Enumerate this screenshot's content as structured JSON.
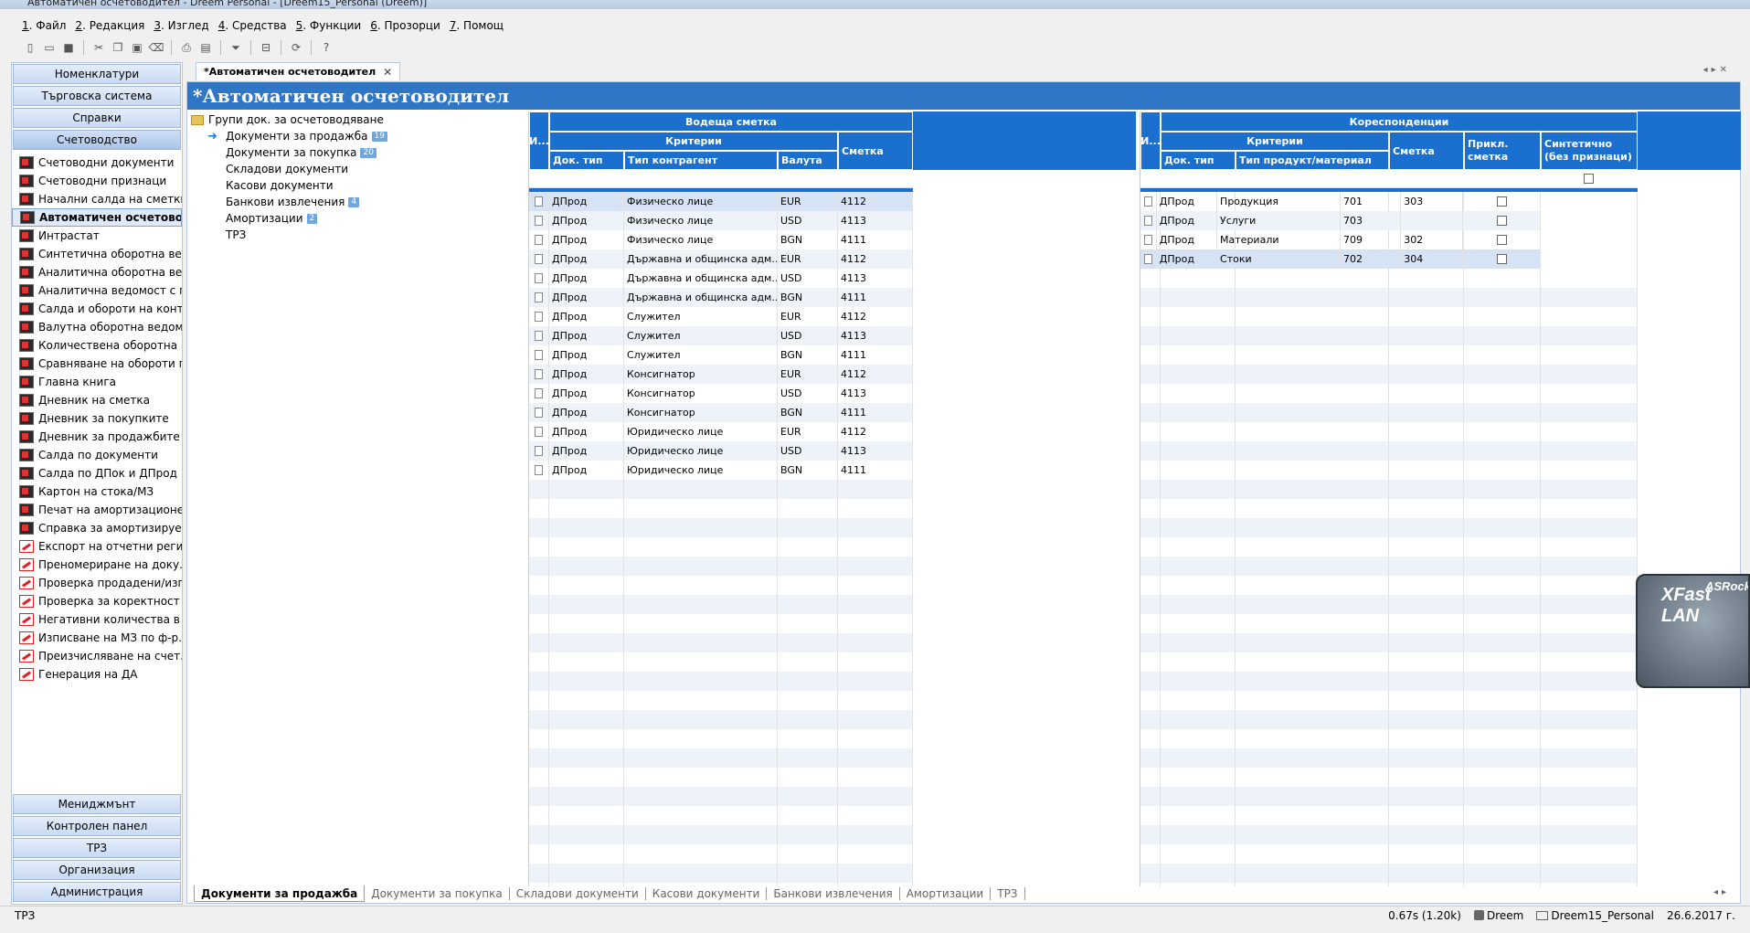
{
  "window": {
    "title": "Автоматичен осчетоводител - Dreem Personal - [Dreem15_Personal (Dreem)]"
  },
  "menu": [
    {
      "num": "1",
      "label": ". Файл"
    },
    {
      "num": "2",
      "label": ". Редакция"
    },
    {
      "num": "3",
      "label": ". Изглед"
    },
    {
      "num": "4",
      "label": ". Средства"
    },
    {
      "num": "5",
      "label": ". Функции"
    },
    {
      "num": "6",
      "label": ". Прозорци"
    },
    {
      "num": "7",
      "label": ". Помощ"
    }
  ],
  "nav": {
    "top_groups": [
      "Номенклатури",
      "Търговска система",
      "Справки",
      "Счетоводство"
    ],
    "items": [
      "Счетоводни документи",
      "Счетоводни признаци",
      "Начални салда на сметки",
      "Автоматичен осчетовод...",
      "Интрастат",
      "Синтетична оборотна вед...",
      "Аналитична оборотна ве...",
      "Аналитична ведомост с п...",
      "Салда и обороти на конт...",
      "Валутна оборотна ведом...",
      "Количествена оборотна в...",
      "Сравняване на обороти п...",
      "Главна книга",
      "Дневник на сметка",
      "Дневник за покупките",
      "Дневник за продажбите",
      "Салда по документи",
      "Салда по ДПок и ДПрод",
      "Картон на стока/МЗ",
      "Печат на амортизационе...",
      "Справка за амортизируе...",
      "Експорт на отчетни регис...",
      "Преномериране на доку...",
      "Проверка продадени/изп...",
      "Проверка за коректност ...",
      "Негативни количества в с...",
      "Изписване на МЗ по ф-р...",
      "Преизчисляване на счет. ...",
      "Генерация на ДА"
    ],
    "bottom_groups": [
      "Мениджмънт",
      "Контролен панел",
      "ТРЗ",
      "Организация",
      "Администрация"
    ]
  },
  "doc_tab": {
    "label": "*Автоматичен осчетоводител",
    "close": "✕"
  },
  "page_title": "*Автоматичен осчетоводител",
  "tree": {
    "root": "Групи док. за осчетоводяване",
    "nodes": [
      {
        "label": "Документи за продажба",
        "badge": "19"
      },
      {
        "label": "Документи за покупка",
        "badge": "20"
      },
      {
        "label": "Складови документи",
        "badge": ""
      },
      {
        "label": "Касови документи",
        "badge": ""
      },
      {
        "label": "Банкови извлечения",
        "badge": "4"
      },
      {
        "label": "Амортизации",
        "badge": "2"
      },
      {
        "label": "ТРЗ",
        "badge": ""
      }
    ]
  },
  "left_grid": {
    "group_title": "Водеща сметка",
    "criteria_title": "Критерии",
    "col_i": "И...",
    "columns": {
      "doc_type": "Док. тип",
      "contractor_type": "Тип контрагент",
      "currency": "Валута",
      "account": "Сметка"
    },
    "rows": [
      [
        "ДПрод",
        "Физическо лице",
        "EUR",
        "4112"
      ],
      [
        "ДПрод",
        "Физическо лице",
        "USD",
        "4113"
      ],
      [
        "ДПрод",
        "Физическо лице",
        "BGN",
        "4111"
      ],
      [
        "ДПрод",
        "Държавна и общинска адм...",
        "EUR",
        "4112"
      ],
      [
        "ДПрод",
        "Държавна и общинска адм...",
        "USD",
        "4113"
      ],
      [
        "ДПрод",
        "Държавна и общинска адм...",
        "BGN",
        "4111"
      ],
      [
        "ДПрод",
        "Служител",
        "EUR",
        "4112"
      ],
      [
        "ДПрод",
        "Служител",
        "USD",
        "4113"
      ],
      [
        "ДПрод",
        "Служител",
        "BGN",
        "4111"
      ],
      [
        "ДПрод",
        "Консигнатор",
        "EUR",
        "4112"
      ],
      [
        "ДПрод",
        "Консигнатор",
        "USD",
        "4113"
      ],
      [
        "ДПрод",
        "Консигнатор",
        "BGN",
        "4111"
      ],
      [
        "ДПрод",
        "Юридическо лице",
        "EUR",
        "4112"
      ],
      [
        "ДПрод",
        "Юридическо лице",
        "USD",
        "4113"
      ],
      [
        "ДПрод",
        "Юридическо лице",
        "BGN",
        "4111"
      ]
    ]
  },
  "right_grid": {
    "group_title": "Кореспонденции",
    "criteria_title": "Критерии",
    "col_i": "И...",
    "columns": {
      "doc_type": "Док. тип",
      "product_type": "Тип продукт/материал",
      "account": "Сметка",
      "attached_account": "Прикл. сметка",
      "synthetic": "Синтетично (без признаци)"
    },
    "rows": [
      [
        "ДПрод",
        "Продукция",
        "701",
        "303"
      ],
      [
        "ДПрод",
        "Услуги",
        "703",
        ""
      ],
      [
        "ДПрод",
        "Материали",
        "709",
        "302"
      ],
      [
        "ДПрод",
        "Стоки",
        "702",
        "304"
      ]
    ]
  },
  "bottom_tabs": [
    "Документи за продажба",
    "Документи за покупка",
    "Складови документи",
    "Касови документи",
    "Банкови извлечения",
    "Амортизации",
    "ТРЗ"
  ],
  "status": {
    "left": "ТРЗ",
    "timing": "0.67s (1.20k)",
    "user": "Dreem",
    "db": "Dreem15_Personal",
    "date": "26.6.2017 г."
  },
  "overlay": {
    "brand": "ASRock",
    "product": "XFast LAN"
  },
  "colors": {
    "header_blue": "#1a6fcf",
    "title_blue": "#2f76c7"
  }
}
